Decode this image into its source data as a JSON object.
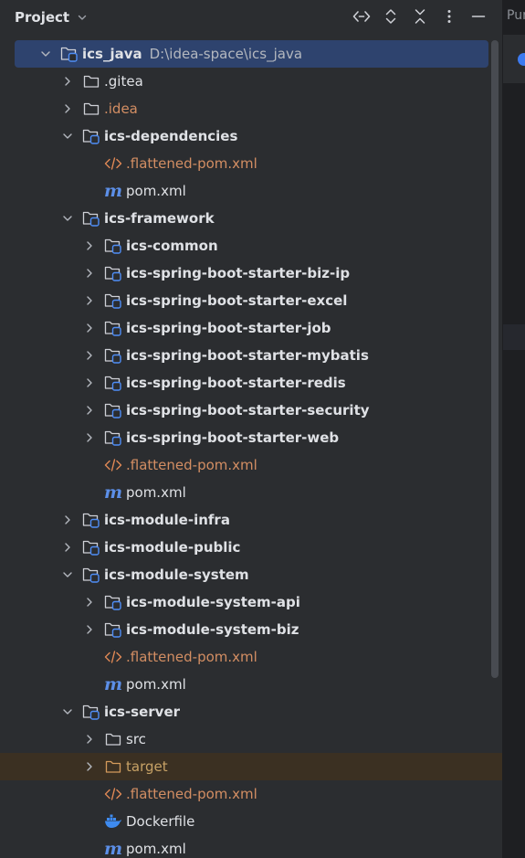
{
  "panel": {
    "title": "Project"
  },
  "editor": {
    "tab_label": "Pur"
  },
  "toolbar": {
    "icons": [
      "locate-icon",
      "expand-all-icon",
      "collapse-all-icon",
      "more-options-icon",
      "minimize-icon"
    ]
  },
  "colors": {
    "background": "#2b2d30",
    "selection": "#2e436e",
    "excluded_highlight": "#3b3022",
    "text": "#dfe1e5",
    "xml_text": "#d38e63",
    "maven_icon": "#5c8fe8",
    "excluded_text": "#c7a266"
  },
  "tree": [
    {
      "label": "ics_java",
      "path": "D:\\idea-space\\ics_java",
      "icon": "module-folder-icon",
      "depth": 0,
      "expanded": true,
      "selected": true,
      "bold": true
    },
    {
      "label": ".gitea",
      "icon": "folder-icon",
      "depth": 1,
      "expanded": false
    },
    {
      "label": ".idea",
      "icon": "folder-icon",
      "depth": 1,
      "expanded": false,
      "style": "orange"
    },
    {
      "label": "ics-dependencies",
      "icon": "module-folder-icon",
      "depth": 1,
      "expanded": true,
      "bold": true
    },
    {
      "label": ".flattened-pom.xml",
      "icon": "xml-file-icon",
      "depth": 2,
      "leaf": true,
      "style": "orange"
    },
    {
      "label": "pom.xml",
      "icon": "maven-icon",
      "depth": 2,
      "leaf": true
    },
    {
      "label": "ics-framework",
      "icon": "module-folder-icon",
      "depth": 1,
      "expanded": true,
      "bold": true
    },
    {
      "label": "ics-common",
      "icon": "module-folder-icon",
      "depth": 2,
      "expanded": false,
      "bold": true
    },
    {
      "label": "ics-spring-boot-starter-biz-ip",
      "icon": "module-folder-icon",
      "depth": 2,
      "expanded": false,
      "bold": true
    },
    {
      "label": "ics-spring-boot-starter-excel",
      "icon": "module-folder-icon",
      "depth": 2,
      "expanded": false,
      "bold": true
    },
    {
      "label": "ics-spring-boot-starter-job",
      "icon": "module-folder-icon",
      "depth": 2,
      "expanded": false,
      "bold": true
    },
    {
      "label": "ics-spring-boot-starter-mybatis",
      "icon": "module-folder-icon",
      "depth": 2,
      "expanded": false,
      "bold": true
    },
    {
      "label": "ics-spring-boot-starter-redis",
      "icon": "module-folder-icon",
      "depth": 2,
      "expanded": false,
      "bold": true
    },
    {
      "label": "ics-spring-boot-starter-security",
      "icon": "module-folder-icon",
      "depth": 2,
      "expanded": false,
      "bold": true
    },
    {
      "label": "ics-spring-boot-starter-web",
      "icon": "module-folder-icon",
      "depth": 2,
      "expanded": false,
      "bold": true
    },
    {
      "label": ".flattened-pom.xml",
      "icon": "xml-file-icon",
      "depth": 2,
      "leaf": true,
      "style": "orange"
    },
    {
      "label": "pom.xml",
      "icon": "maven-icon",
      "depth": 2,
      "leaf": true
    },
    {
      "label": "ics-module-infra",
      "icon": "module-folder-icon",
      "depth": 1,
      "expanded": false,
      "bold": true
    },
    {
      "label": "ics-module-public",
      "icon": "module-folder-icon",
      "depth": 1,
      "expanded": false,
      "bold": true
    },
    {
      "label": "ics-module-system",
      "icon": "module-folder-icon",
      "depth": 1,
      "expanded": true,
      "bold": true
    },
    {
      "label": "ics-module-system-api",
      "icon": "module-folder-icon",
      "depth": 2,
      "expanded": false,
      "bold": true
    },
    {
      "label": "ics-module-system-biz",
      "icon": "module-folder-icon",
      "depth": 2,
      "expanded": false,
      "bold": true
    },
    {
      "label": ".flattened-pom.xml",
      "icon": "xml-file-icon",
      "depth": 2,
      "leaf": true,
      "style": "orange"
    },
    {
      "label": "pom.xml",
      "icon": "maven-icon",
      "depth": 2,
      "leaf": true
    },
    {
      "label": "ics-server",
      "icon": "module-folder-icon",
      "depth": 1,
      "expanded": true,
      "bold": true
    },
    {
      "label": "src",
      "icon": "folder-icon",
      "depth": 2,
      "expanded": false
    },
    {
      "label": "target",
      "icon": "excluded-folder-icon",
      "depth": 2,
      "expanded": false,
      "style": "gold",
      "highlight": true
    },
    {
      "label": ".flattened-pom.xml",
      "icon": "xml-file-icon",
      "depth": 2,
      "leaf": true,
      "style": "orange"
    },
    {
      "label": "Dockerfile",
      "icon": "docker-icon",
      "depth": 2,
      "leaf": true
    },
    {
      "label": "pom.xml",
      "icon": "maven-icon",
      "depth": 2,
      "leaf": true
    }
  ]
}
